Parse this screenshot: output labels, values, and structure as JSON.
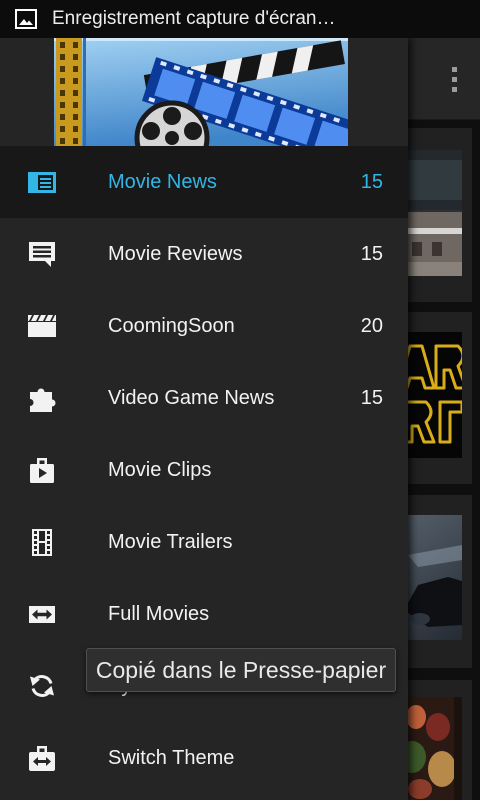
{
  "status_bar": {
    "icon": "image-icon",
    "title": "Enregistrement capture d'écran…"
  },
  "colors": {
    "accent": "#33b5e5",
    "drawer_background": "#252525",
    "selected_background": "#181818"
  },
  "drawer": {
    "items": [
      {
        "icon": "newspaper-icon",
        "label": "Movie News",
        "count": "15",
        "selected": true
      },
      {
        "icon": "chat-bubble-icon",
        "label": "Movie Reviews",
        "count": "15",
        "selected": false
      },
      {
        "icon": "clapperboard-icon",
        "label": "CoomingSoon",
        "count": "20",
        "selected": false
      },
      {
        "icon": "puzzle-icon",
        "label": "Video Game News",
        "count": "15",
        "selected": false
      },
      {
        "icon": "play-case-icon",
        "label": "Movie Clips",
        "selected": false
      },
      {
        "icon": "film-strip-icon",
        "label": "Movie Trailers",
        "selected": false
      },
      {
        "icon": "swap-arrows-icon",
        "label": "Full Movies",
        "selected": false
      },
      {
        "icon": "sync-icon",
        "label": "Sync Now",
        "selected": false
      },
      {
        "icon": "toolbox-swap-icon",
        "label": "Switch Theme",
        "selected": false
      }
    ]
  },
  "main": {
    "overflow_icon": "overflow-menu-icon"
  },
  "toast": {
    "text": "Copié dans le Presse-papier"
  }
}
